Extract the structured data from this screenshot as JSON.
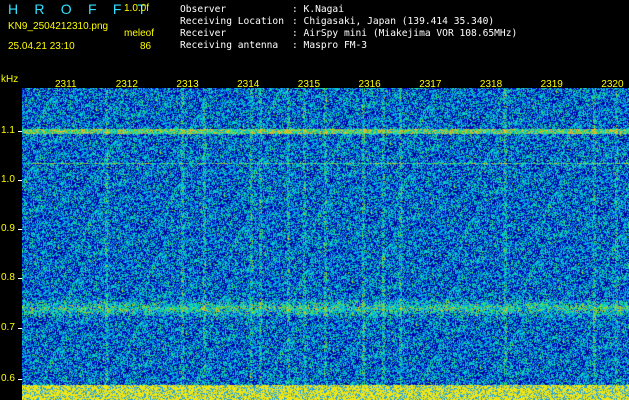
{
  "header": {
    "logo": "H R O F F T",
    "version": "1.0.0f",
    "filename": "KN9_2504212310.png",
    "meter_label": "meleof",
    "timestamp": "25.04.21 23:10",
    "meter_value": "86"
  },
  "info": {
    "rows": [
      {
        "key": "Observer",
        "value": ": K.Nagai"
      },
      {
        "key": "Receiving Location",
        "value": ": Chigasaki, Japan (139.414 35.340)"
      },
      {
        "key": "Receiver",
        "value": ": AirSpy mini (Miakejima VOR 108.65MHz)"
      },
      {
        "key": "Receiving antenna",
        "value": ": Maspro FM-3"
      }
    ]
  },
  "axes": {
    "y_unit": "kHz",
    "y_ticks": [
      "1.1",
      "1.0",
      "0.9",
      "0.8",
      "0.7",
      "0.6"
    ],
    "x_ticks": [
      "2311",
      "2312",
      "2313",
      "2314",
      "2315",
      "2316",
      "2317",
      "2318",
      "2319",
      "2320"
    ]
  },
  "colors": {
    "header_text": "#ffff00",
    "logo": "#33e0ff",
    "info_text": "#ffffff",
    "background": "#000000"
  }
}
